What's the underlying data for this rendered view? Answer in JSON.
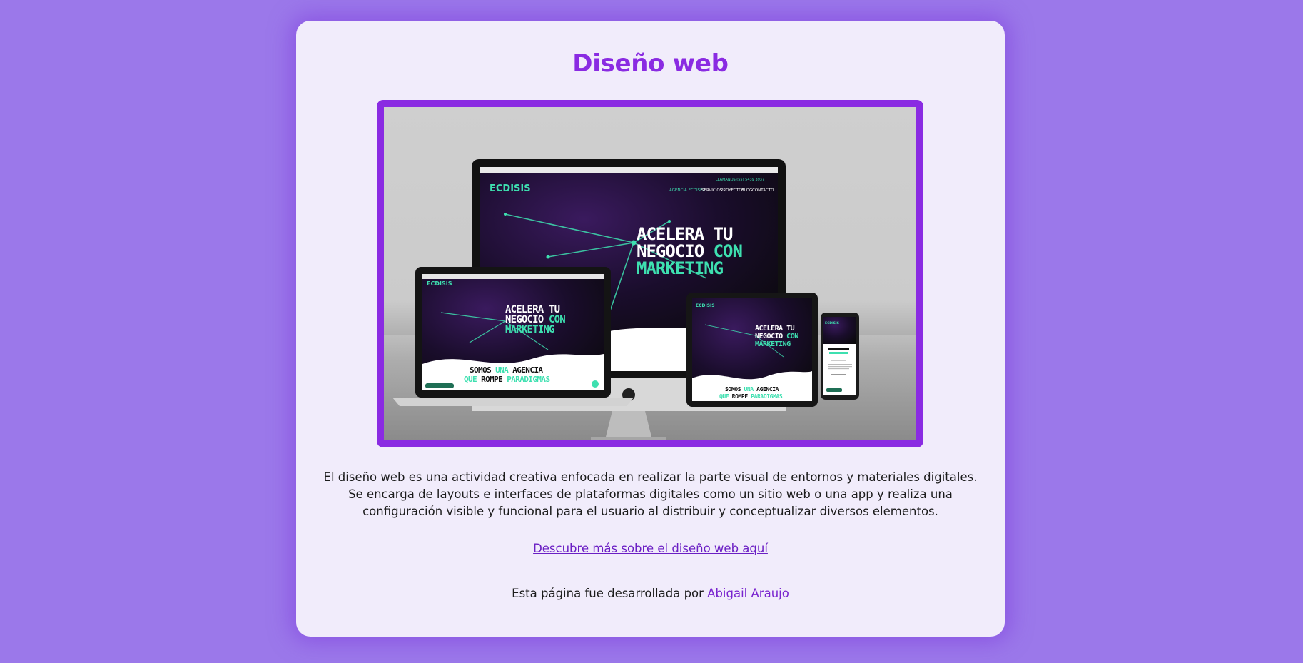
{
  "page": {
    "title": "Diseño web",
    "description": "El diseño web es una actividad creativa enfocada en realizar la parte visual de entornos y materiales digitales. Se encarga de layouts e interfaces de plataformas digitales como un sitio web o una app y realiza una configuración visible y funcional para el usuario al distribuir y conceptualizar diversos elementos.",
    "more_link": "Descubre más sobre el diseño web aquí",
    "credit_prefix": "Esta página fue desarrollada por ",
    "author": "Abigail Araujo"
  },
  "image": {
    "hero_line1": "ACELERA TU",
    "hero_line2_a": "NEGOCIO ",
    "hero_line2_b": "CON",
    "hero_line3": "MARKETING",
    "brand": "ECDISIS",
    "tag_line1_a": "SOMOS ",
    "tag_line1_b": "UNA",
    "tag_line1_c": " AGENCIA",
    "tag_line2_a": "QUE ",
    "tag_line2_b": "ROMPE",
    "tag_line2_c": " PARADIGMAS",
    "nav_items": [
      "AGENCIA ECDISIS",
      "SERVICIOS",
      "PROYECTOS",
      "BLOG",
      "CONTACTO"
    ],
    "phone_label": "LLÁMANOS (55) 5439 3937"
  },
  "colors": {
    "accent": "#8a2be2",
    "background": "#9b78ea",
    "card": "#f1ecfb",
    "mint": "#3ee0b0"
  }
}
